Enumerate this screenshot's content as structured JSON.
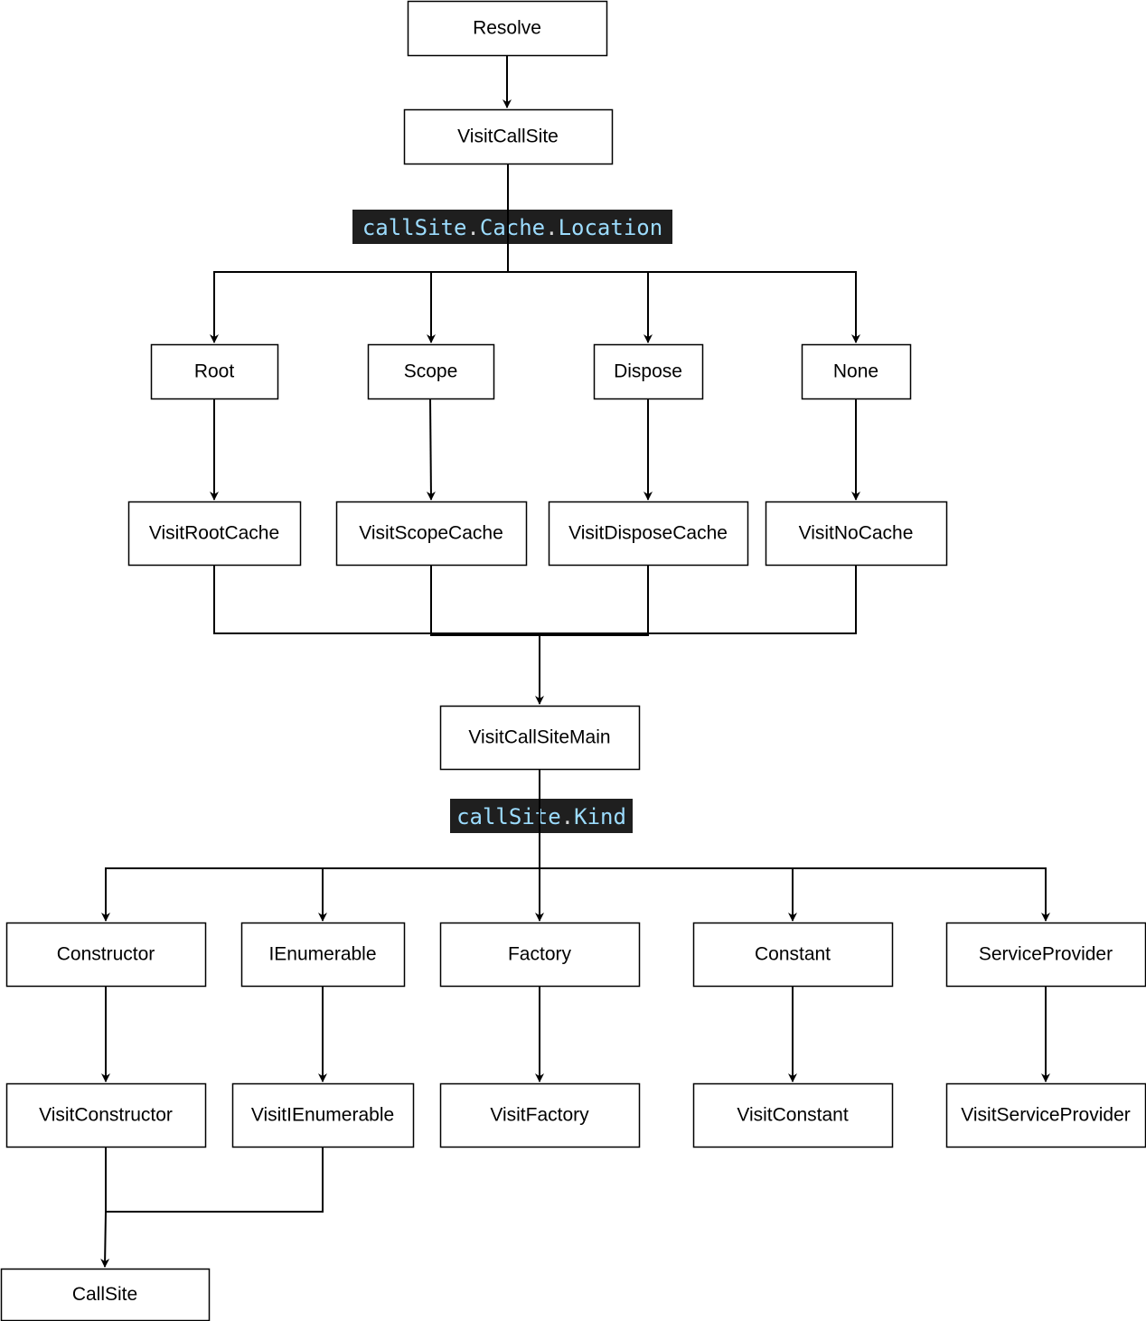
{
  "nodes": {
    "resolve": "Resolve",
    "visit_call_site": "VisitCallSite",
    "root": "Root",
    "scope": "Scope",
    "dispose": "Dispose",
    "none": "None",
    "visit_root_cache": "VisitRootCache",
    "visit_scope_cache": "VisitScopeCache",
    "visit_dispose_cache": "VisitDisposeCache",
    "visit_no_cache": "VisitNoCache",
    "visit_call_site_main": "VisitCallSiteMain",
    "constructor": "Constructor",
    "ienumerable": "IEnumerable",
    "factory": "Factory",
    "constant": "Constant",
    "service_provider": "ServiceProvider",
    "visit_constructor": "VisitConstructor",
    "visit_ienumerable": "VisitIEnumerable",
    "visit_factory": "VisitFactory",
    "visit_constant": "VisitConstant",
    "visit_service_provider": "VisitServiceProvider",
    "call_site": "CallSite"
  },
  "labels": {
    "cache_location": "callSite.Cache.Location",
    "kind": "callSite.Kind"
  },
  "colors": {
    "code_bg": "#1f1f1f",
    "code_identifier": "#9cdcfe",
    "code_punct": "#d4d4d4"
  }
}
